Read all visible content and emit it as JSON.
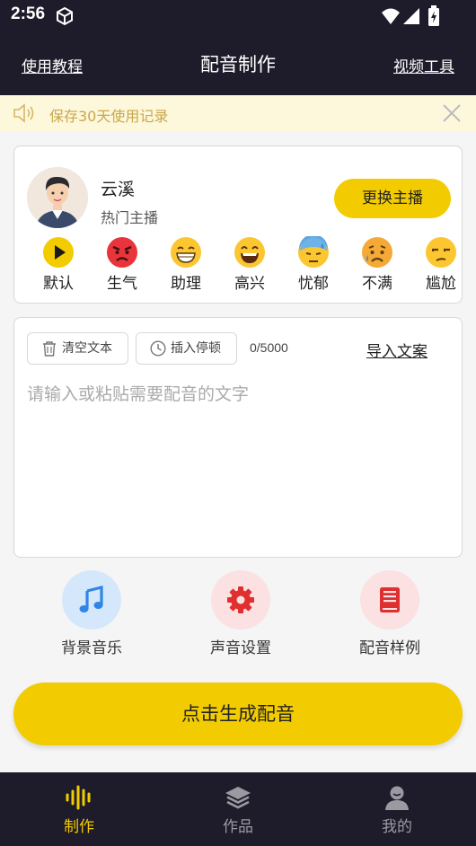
{
  "status_bar": {
    "time": "2:56"
  },
  "header": {
    "left_link": "使用教程",
    "title": "配音制作",
    "right_link": "视频工具"
  },
  "notice": {
    "text": "保存30天使用记录"
  },
  "anchor": {
    "name": "云溪",
    "subtitle": "热门主播",
    "change_button": "更换主播"
  },
  "emotions": [
    {
      "label": "默认",
      "icon": "play-icon"
    },
    {
      "label": "生气",
      "icon": "angry-face-icon"
    },
    {
      "label": "助理",
      "icon": "grin-face-icon"
    },
    {
      "label": "高兴",
      "icon": "happy-face-icon"
    },
    {
      "label": "忧郁",
      "icon": "sweat-face-icon"
    },
    {
      "label": "不满",
      "icon": "sad-face-icon"
    },
    {
      "label": "尴尬",
      "icon": "unamused-face-icon"
    }
  ],
  "editor": {
    "clear_button": "清空文本",
    "pause_button": "插入停顿",
    "counter": "0/5000",
    "import_link": "导入文案",
    "placeholder": "请输入或粘贴需要配音的文字"
  },
  "functions": [
    {
      "label": "背景音乐",
      "icon": "music-note-icon",
      "color": "#2f86e8"
    },
    {
      "label": "声音设置",
      "icon": "gear-icon",
      "color": "#e02f2f"
    },
    {
      "label": "配音样例",
      "icon": "book-icon",
      "color": "#e02f2f"
    }
  ],
  "generate_button": "点击生成配音",
  "tabs": [
    {
      "label": "制作",
      "icon": "waveform-icon",
      "active": true
    },
    {
      "label": "作品",
      "icon": "layers-icon",
      "active": false
    },
    {
      "label": "我的",
      "icon": "user-icon",
      "active": false
    }
  ],
  "colors": {
    "accent": "#f2cc00",
    "dark": "#1e1c2a",
    "notice_bg": "#fdf7dc",
    "notice_text": "#c9a84a"
  }
}
